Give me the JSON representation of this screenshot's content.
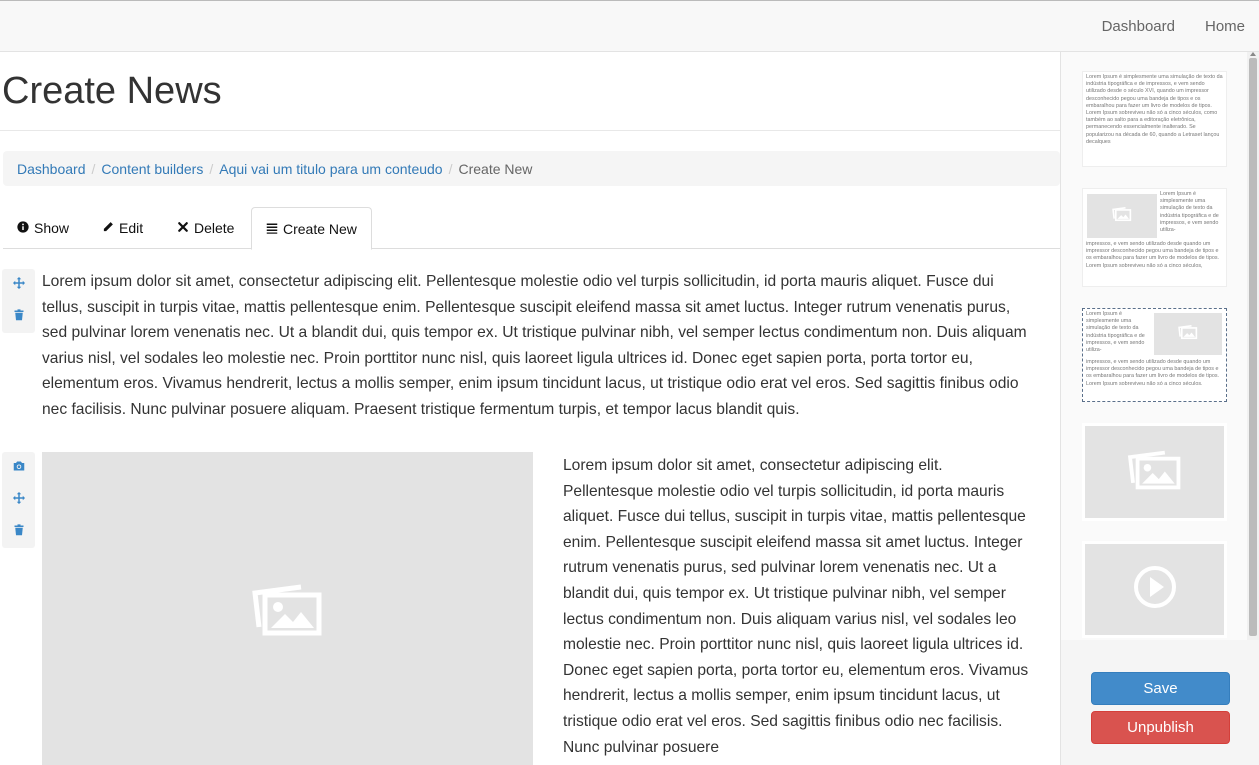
{
  "topnav": {
    "items": [
      "Dashboard",
      "Home"
    ]
  },
  "page": {
    "title": "Create News"
  },
  "breadcrumb": {
    "items": [
      "Dashboard",
      "Content builders",
      "Aqui vai um titulo para um conteudo"
    ],
    "active": "Create New"
  },
  "tabs": [
    {
      "label": "Show",
      "icon": "info-circle-icon"
    },
    {
      "label": "Edit",
      "icon": "pencil-icon"
    },
    {
      "label": "Delete",
      "icon": "times-icon"
    },
    {
      "label": "Create New",
      "icon": "list-icon",
      "active": true
    }
  ],
  "blocks": {
    "text_block": {
      "text": "Lorem ipsum dolor sit amet, consectetur adipiscing elit. Pellentesque molestie odio vel turpis sollicitudin, id porta mauris aliquet. Fusce dui tellus, suscipit in turpis vitae, mattis pellentesque enim. Pellentesque suscipit eleifend massa sit amet luctus. Integer rutrum venenatis purus, sed pulvinar lorem venenatis nec. Ut a blandit dui, quis tempor ex. Ut tristique pulvinar nibh, vel semper lectus condimentum non. Duis aliquam varius nisl, vel sodales leo molestie nec. Proin porttitor nunc nisl, quis laoreet ligula ultrices id. Donec eget sapien porta, porta tortor eu, elementum eros. Vivamus hendrerit, lectus a mollis semper, enim ipsum tincidunt lacus, ut tristique odio erat vel eros. Sed sagittis finibus odio nec facilisis. Nunc pulvinar posuere aliquam. Praesent tristique fermentum turpis, et tempor lacus blandit quis."
    },
    "image_text_block": {
      "text": "Lorem ipsum dolor sit amet, consectetur adipiscing elit. Pellentesque molestie odio vel turpis sollicitudin, id porta mauris aliquet. Fusce dui tellus, suscipit in turpis vitae, mattis pellentesque enim. Pellentesque suscipit eleifend massa sit amet luctus. Integer rutrum venenatis purus, sed pulvinar lorem venenatis nec. Ut a blandit dui, quis tempor ex. Ut tristique pulvinar nibh, vel semper lectus condimentum non. Duis aliquam varius nisl, vel sodales leo molestie nec. Proin porttitor nunc nisl, quis laoreet ligula ultrices id. Donec eget sapien porta, porta tortor eu, elementum eros. Vivamus hendrerit, lectus a mollis semper, enim ipsum tincidunt lacus, ut tristique odio erat vel eros. Sed sagittis finibus odio nec facilisis. Nunc pulvinar posuere"
    }
  },
  "sidebar": {
    "snippet_text_1": "Lorem Ipsum é simplesmente uma simulação de texto da indústria tipográfica e de impressos, e vem sendo utilizado desde o século XVI, quando um impressor desconhecido pegou uma bandeja de tipos e os embaralhou para fazer um livro de modelos de tipos. Lorem Ipsum sobreviveu não só a cinco séculos, como também ao salto para a editoração eletrônica, permanecendo essencialmente inalterado. Se popularizou na década de 60, quando a Letraset lançou decalques",
    "snippet_text_2_side": "Lorem Ipsum é simplesmente uma simulação de texto da indústria tipográfica e de impressos, e vem sendo utiliza-",
    "snippet_text_2_bottom": "impressos, e vem sendo utilizado desde quando um impressor desconhecido pegou uma bandeja de tipos e os embaralhou para fazer um livro de modelos de tipos. Lorem Ipsum sobreviveu não só a cinco séculos,",
    "snippet_text_3_side": "Lorem Ipsum é simplesmente uma simulação de texto da indústria tipográfica e de impressos, e vem sendo utiliza-",
    "snippet_text_3_bottom": "impressos, e vem sendo utilizado desde quando um impressor desconhecido pegou uma bandeja de tipos e os embaralhou para fazer um livro de modelos de tipos. Lorem Ipsum sobreviveu não só a cinco séculos.",
    "save_label": "Save",
    "unpublish_label": "Unpublish"
  },
  "colors": {
    "link": "#337ab7",
    "save": "#428bca",
    "unpublish": "#d9534f",
    "tool_icon": "#3a87c7"
  }
}
